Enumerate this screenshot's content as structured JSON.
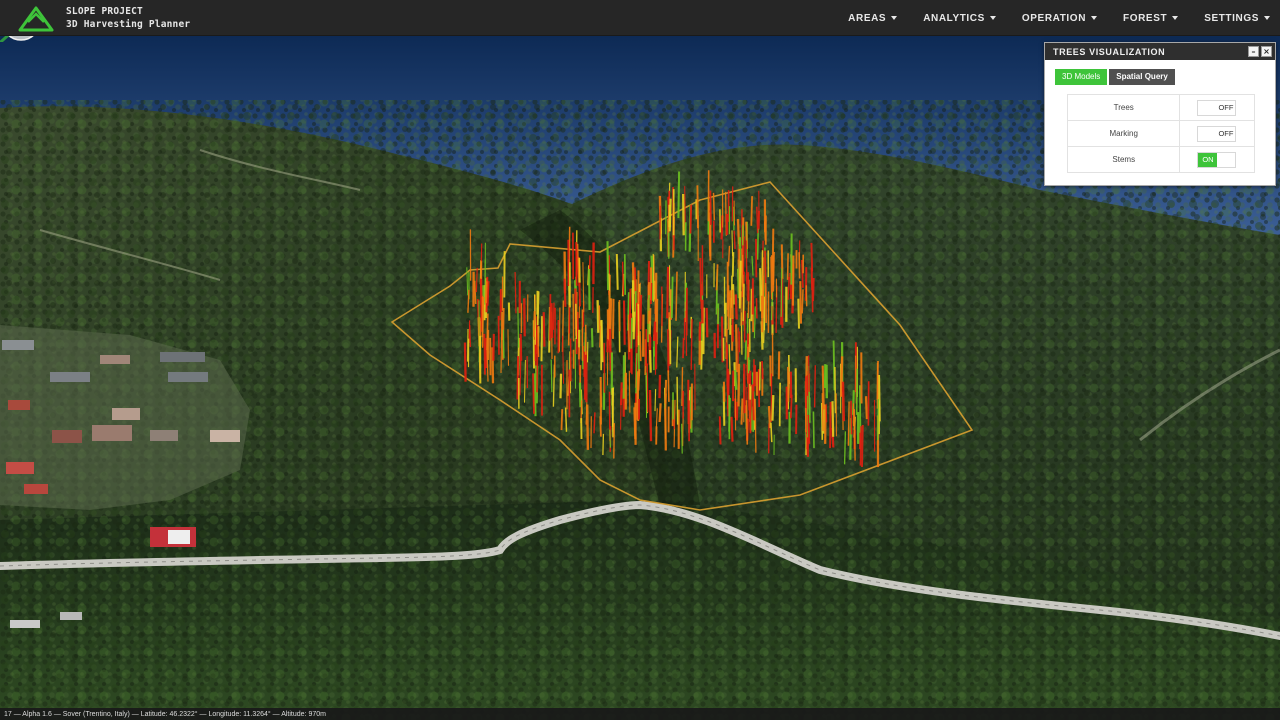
{
  "app": {
    "title": "SLOPE PROJECT",
    "subtitle": "3D Harvesting Planner"
  },
  "nav": {
    "items": [
      {
        "label": "AREAS"
      },
      {
        "label": "ANALYTICS"
      },
      {
        "label": "OPERATION"
      },
      {
        "label": "FOREST"
      },
      {
        "label": "SETTINGS"
      }
    ]
  },
  "panel": {
    "title": "TREES VISUALIZATION",
    "tabs": [
      {
        "label": "3D Models",
        "active": true
      },
      {
        "label": "Spatial Query",
        "active": false
      }
    ],
    "toggles": [
      {
        "label": "Trees",
        "state": "OFF"
      },
      {
        "label": "Marking",
        "state": "OFF"
      },
      {
        "label": "Stems",
        "state": "ON"
      }
    ]
  },
  "status": {
    "text": "17 — Alpha 1.6 — Sover (Trentino, Italy) — Latitude: 46.2322° — Longitude: 11.3264° — Altitude: 970m"
  },
  "colors": {
    "accent_green": "#3ec43a",
    "navbar": "#262626",
    "boundary": "#d9a030",
    "stem_red": "#e02010",
    "stem_orange": "#f07a10",
    "stem_yellow": "#e8d020",
    "stem_green": "#6cc020"
  }
}
